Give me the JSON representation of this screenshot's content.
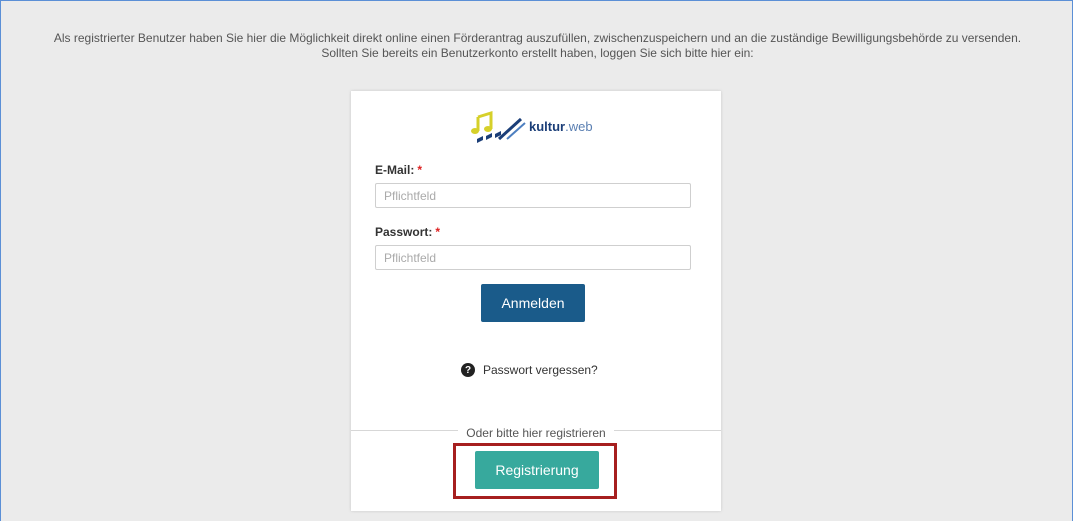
{
  "intro": {
    "line1": "Als registrierter Benutzer haben Sie hier die Möglichkeit direkt online einen Förderantrag auszufüllen, zwischenzuspeichern und an die zuständige Bewilligungsbehörde zu versenden.",
    "line2": "Sollten Sie bereits ein Benutzerkonto erstellt haben, loggen Sie sich bitte hier ein:"
  },
  "logo": {
    "brand": "kultur",
    "suffix": ".web"
  },
  "form": {
    "email_label": "E-Mail:",
    "email_placeholder": "Pflichtfeld",
    "password_label": "Passwort:",
    "password_placeholder": "Pflichtfeld",
    "required_marker": "*",
    "login_button": "Anmelden",
    "forgot_password": "Passwort vergessen?"
  },
  "register": {
    "divider_text": "Oder bitte hier registrieren",
    "button": "Registrierung"
  },
  "colors": {
    "login_button": "#1a5b8a",
    "register_button": "#37a99d",
    "highlight_border": "#a61f1f",
    "required": "#dd2222"
  }
}
